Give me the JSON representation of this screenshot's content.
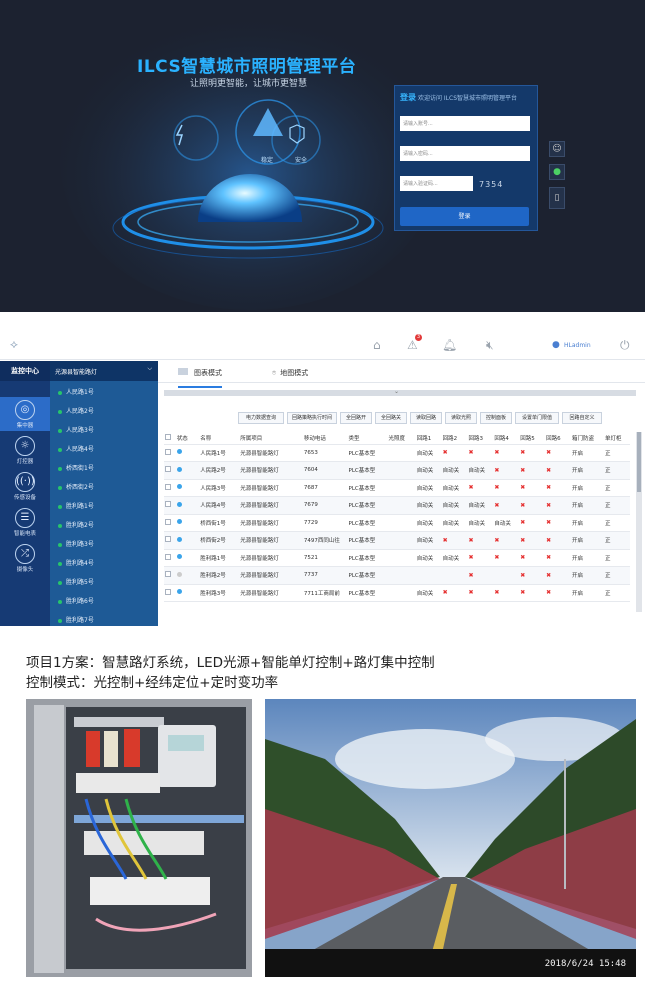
{
  "login": {
    "title": "ILCS智慧城市照明管理平台",
    "subtitle": "让照明更智能，让城市更智慧",
    "emblem_labels": [
      "稳定",
      "安全"
    ],
    "form": {
      "heading": "登录",
      "welcome": "欢迎访问 ILCS智慧城市照明管理平台",
      "account_placeholder": "请输入账号...",
      "password_placeholder": "请输入密码...",
      "captcha_placeholder": "请输入验证码...",
      "captcha_code": "7354",
      "submit_label": "登录"
    },
    "side_icons": [
      "qq-icon",
      "wechat-icon",
      "phone-icon"
    ]
  },
  "app": {
    "user": "HLadmin",
    "alert_badge": "3",
    "sidebar": {
      "title": "监控中心",
      "items": [
        {
          "label": "集中器",
          "icon": "concentrator-icon",
          "active": true
        },
        {
          "label": "灯控器",
          "icon": "bulb-icon",
          "active": false
        },
        {
          "label": "传感设备",
          "icon": "sensor-icon",
          "active": false
        },
        {
          "label": "智能电表",
          "icon": "meter-icon",
          "active": false
        },
        {
          "label": "摄像头",
          "icon": "shuffle-icon",
          "active": false
        }
      ]
    },
    "tree": {
      "header": "光源县智能路灯",
      "nodes": [
        "人民路1号",
        "人民路2号",
        "人民路3号",
        "人民路4号",
        "桥西街1号",
        "桥西街2号",
        "胜利路1号",
        "胜利路2号",
        "胜利路3号",
        "胜利路4号",
        "胜利路5号",
        "胜利路6号",
        "胜利路7号"
      ]
    },
    "tabs": [
      "图表模式",
      "地图模式"
    ],
    "actions": [
      "电力数据查询",
      "回路策略执行时间",
      "全回路开",
      "全回路关",
      "读取回路",
      "读取光照",
      "控制面板",
      "设置单门限值",
      "回路自定义"
    ],
    "table": {
      "columns": [
        "状态",
        "名称",
        "所属项目",
        "移动电话",
        "类型",
        "光照度",
        "回路1",
        "回路2",
        "回路3",
        "回路4",
        "回路5",
        "回路6",
        "箱门防盗",
        "单灯柜"
      ],
      "rows": [
        {
          "online": true,
          "name": "人民路1号",
          "project": "光源县智能路灯",
          "phone": "7653",
          "type": "PLC基本型",
          "lux": "",
          "loops": [
            "自动关",
            "x",
            "x",
            "x",
            "x",
            "x"
          ],
          "door": "开启",
          "last": "正"
        },
        {
          "online": true,
          "name": "人民路2号",
          "project": "光源县智能路灯",
          "phone": "7604",
          "type": "PLC基本型",
          "lux": "",
          "loops": [
            "自动关",
            "自动关",
            "自动关",
            "x",
            "x",
            "x"
          ],
          "door": "开启",
          "last": "正"
        },
        {
          "online": true,
          "name": "人民路3号",
          "project": "光源县智能路灯",
          "phone": "7687",
          "type": "PLC基本型",
          "lux": "",
          "loops": [
            "自动关",
            "自动关",
            "x",
            "x",
            "x",
            "x"
          ],
          "door": "开启",
          "last": "正"
        },
        {
          "online": true,
          "name": "人民路4号",
          "project": "光源县智能路灯",
          "phone": "7679",
          "type": "PLC基本型",
          "lux": "",
          "loops": [
            "自动关",
            "自动关",
            "自动关",
            "x",
            "x",
            "x"
          ],
          "door": "开启",
          "last": "正"
        },
        {
          "online": true,
          "name": "桥西街1号",
          "project": "光源县智能路灯",
          "phone": "7729",
          "type": "PLC基本型",
          "lux": "",
          "loops": [
            "自动关",
            "自动关",
            "自动关",
            "自动关",
            "x",
            "x"
          ],
          "door": "开启",
          "last": "正"
        },
        {
          "online": true,
          "name": "桥西街2号",
          "project": "光源县智能路灯",
          "phone": "7497西同山往",
          "type": "PLC基本型",
          "lux": "",
          "loops": [
            "自动关",
            "x",
            "x",
            "x",
            "x",
            "x"
          ],
          "door": "开启",
          "last": "正"
        },
        {
          "online": true,
          "name": "胜利路1号",
          "project": "光源县智能路灯",
          "phone": "7521",
          "type": "PLC基本型",
          "lux": "",
          "loops": [
            "自动关",
            "自动关",
            "x",
            "x",
            "x",
            "x"
          ],
          "door": "开启",
          "last": "正"
        },
        {
          "online": false,
          "name": "胜利路2号",
          "project": "光源县智能路灯",
          "phone": "7737",
          "type": "PLC基本型",
          "lux": "",
          "loops": [
            "",
            "",
            "x",
            "",
            "x",
            "x"
          ],
          "door": "开启",
          "last": "正"
        },
        {
          "online": true,
          "name": "胜利路3号",
          "project": "光源县智能路灯",
          "phone": "7711工商局前",
          "type": "PLC基本型",
          "lux": "",
          "loops": [
            "自动关",
            "x",
            "x",
            "x",
            "x",
            "x"
          ],
          "door": "开启",
          "last": "正"
        }
      ]
    }
  },
  "caption": {
    "line1": "项目1方案：智慧路灯系统，LED光源+智能单灯控制+路灯集中控制",
    "line2": "控制模式：光控制+经纬定位+定时变功率"
  },
  "photo2_timestamp": "2018/6/24  15:48"
}
